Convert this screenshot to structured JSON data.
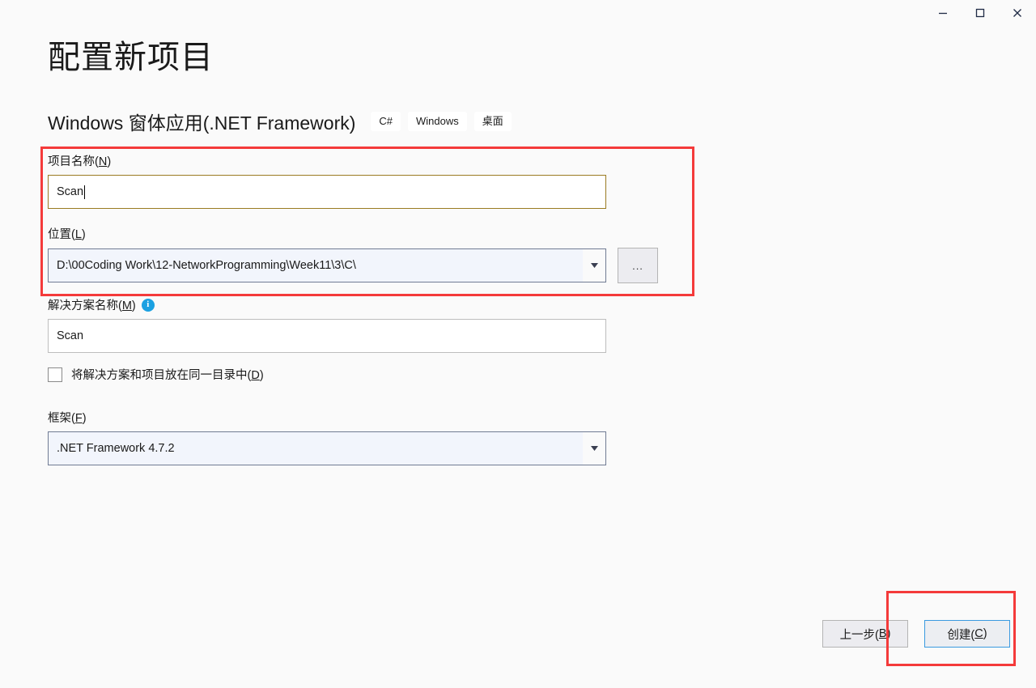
{
  "window": {
    "controls": [
      {
        "name": "minimize",
        "label": "─"
      },
      {
        "name": "maximize",
        "label": "□"
      },
      {
        "name": "close",
        "label": "✕"
      }
    ]
  },
  "header": {
    "title": "配置新项目",
    "subtitle": "Windows 窗体应用(.NET Framework)",
    "tags": [
      "C#",
      "Windows",
      "桌面"
    ]
  },
  "form": {
    "project_name": {
      "label_prefix": "项目名称(",
      "label_key": "N",
      "label_suffix": ")",
      "value": "Scan",
      "placeholder": ""
    },
    "location": {
      "label_prefix": "位置(",
      "label_key": "L",
      "label_suffix": ")",
      "value": "D:\\00Coding Work\\12-NetworkProgramming\\Week11\\3\\C\\",
      "browse_label": "..."
    },
    "solution_name": {
      "label_prefix": "解决方案名称(",
      "label_key": "M",
      "label_suffix": ")",
      "info_glyph": "i",
      "value": "Scan"
    },
    "same_dir_checkbox": {
      "label_prefix": "将解决方案和项目放在同一目录中(",
      "label_key": "D",
      "label_suffix": ")",
      "checked": false
    },
    "framework": {
      "label_prefix": "框架(",
      "label_key": "F",
      "label_suffix": ")",
      "value": ".NET Framework 4.7.2"
    }
  },
  "footer": {
    "back_prefix": "上一步(",
    "back_key": "B",
    "back_suffix": ")",
    "create_prefix": "创建(",
    "create_key": "C",
    "create_suffix": ")"
  },
  "colors": {
    "page_background": "#fafafa",
    "annotation_red": "#f43a3a",
    "focused_border": "#9a7b22",
    "combo_background": "#f2f5fc",
    "create_border": "#3a9ae0",
    "info_blue": "#1ba1e2"
  }
}
